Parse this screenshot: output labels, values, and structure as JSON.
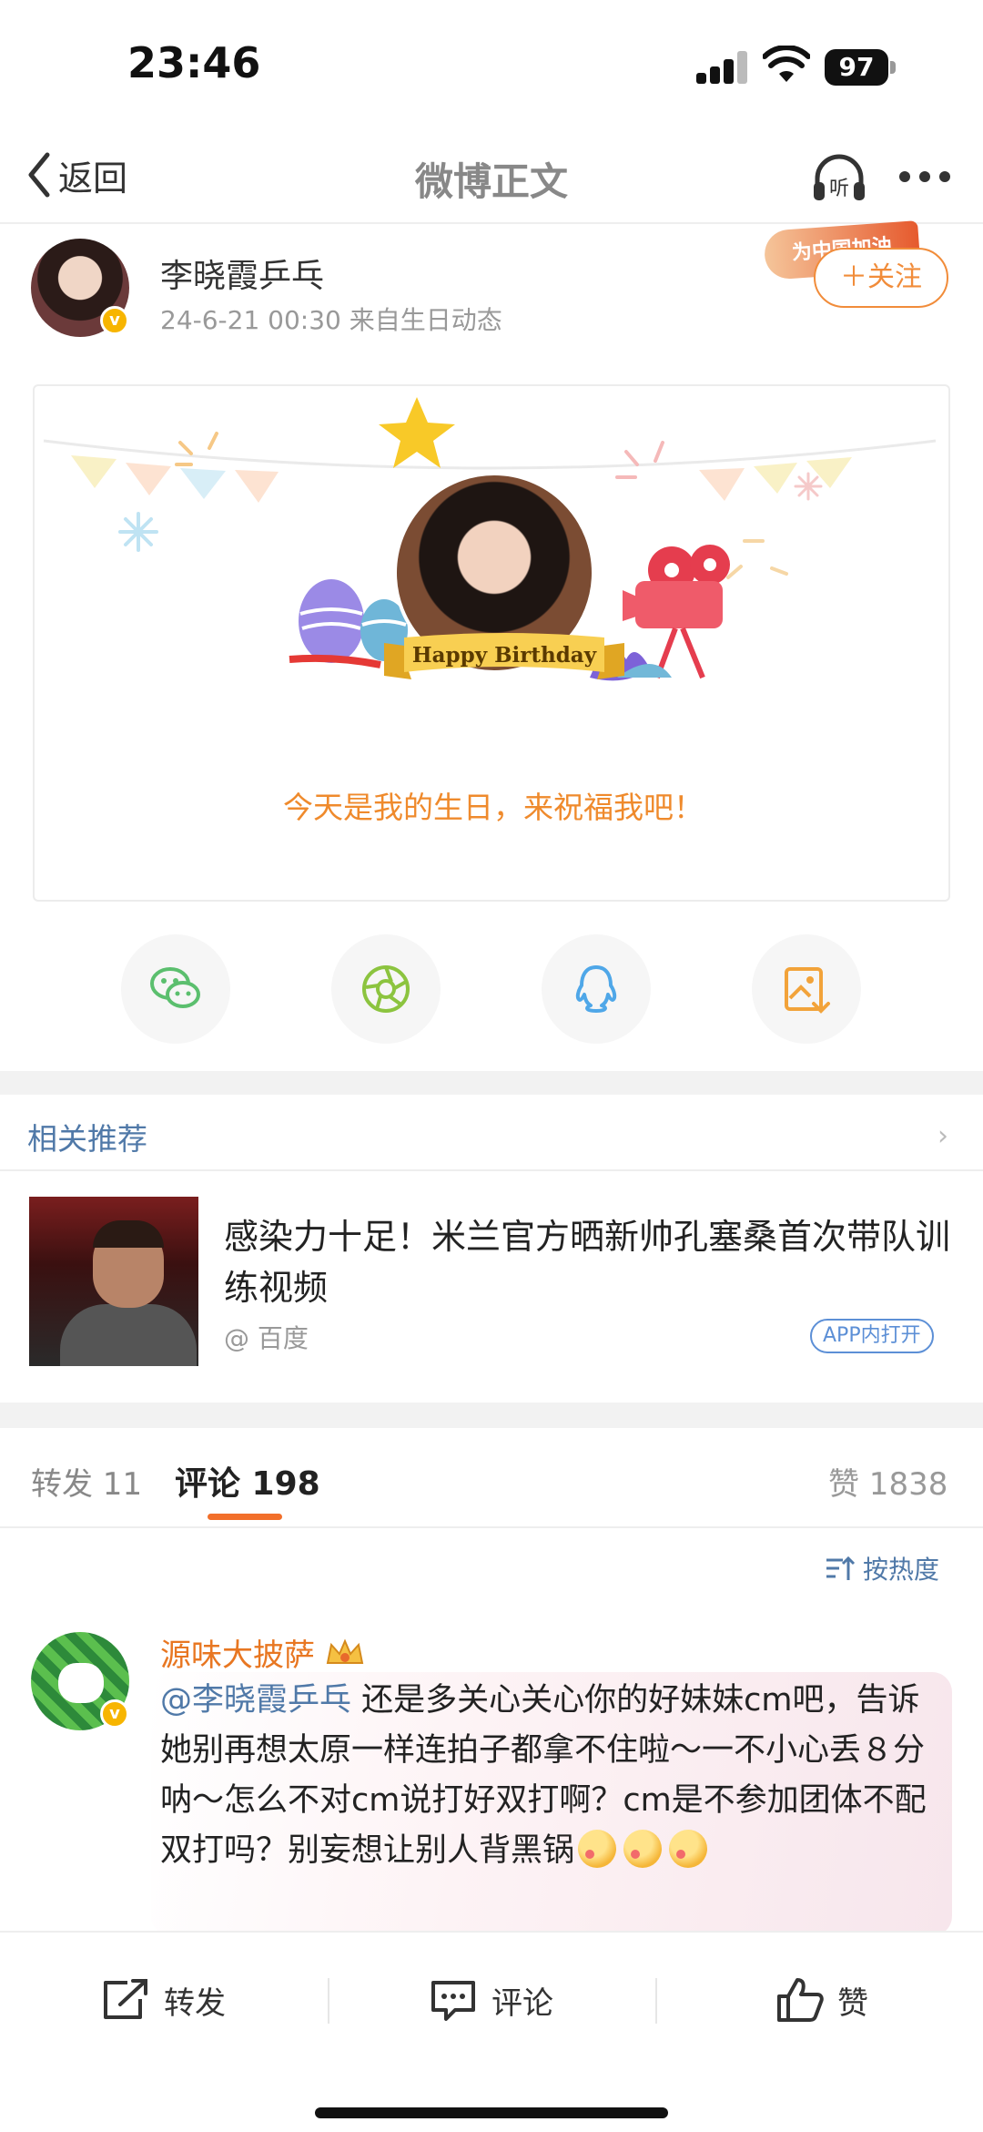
{
  "status": {
    "time": "23:46",
    "battery": "97"
  },
  "nav": {
    "back_label": "返回",
    "title": "微博正文",
    "listen_label": "听"
  },
  "post": {
    "author": "李晓霞乒乓",
    "meta": "24-6-21 00:30  来自生日动态",
    "cheer_badge": "为中国加油",
    "follow_label": "＋关注",
    "card": {
      "ribbon_text": "Happy Birthday",
      "caption": "今天是我的生日，来祝福我吧！"
    }
  },
  "share_icons": [
    "wechat-icon",
    "moments-icon",
    "qq-icon",
    "save-image-icon"
  ],
  "related": {
    "title": "相关推荐",
    "item": {
      "title": "感染力十足！米兰官方晒新帅孔塞桑首次带队训练视频",
      "source": "@ 百度",
      "app_label": "APP内打开"
    }
  },
  "tabs": {
    "repost": "转发 11",
    "comment": "评论 198",
    "like": "赞 1838"
  },
  "sort": {
    "label": "按热度"
  },
  "comment": {
    "user": "源味大披萨",
    "mention": "@李晓霞乒乓",
    "text": " 还是多关心关心你的好妹妹cm吧，告诉她别再想太原一样连拍子都拿不住啦～一不小心丢８分呐～怎么不对cm说打好双打啊？cm是不参加团体不配双打吗？别妄想让别人背黑锅"
  },
  "bottom_bar": {
    "repost": "转发",
    "comment": "评论",
    "like": "赞"
  },
  "colors": {
    "accent_orange": "#f18c3a",
    "link_blue": "#5079a8",
    "tab_underline": "#f26f2a"
  }
}
